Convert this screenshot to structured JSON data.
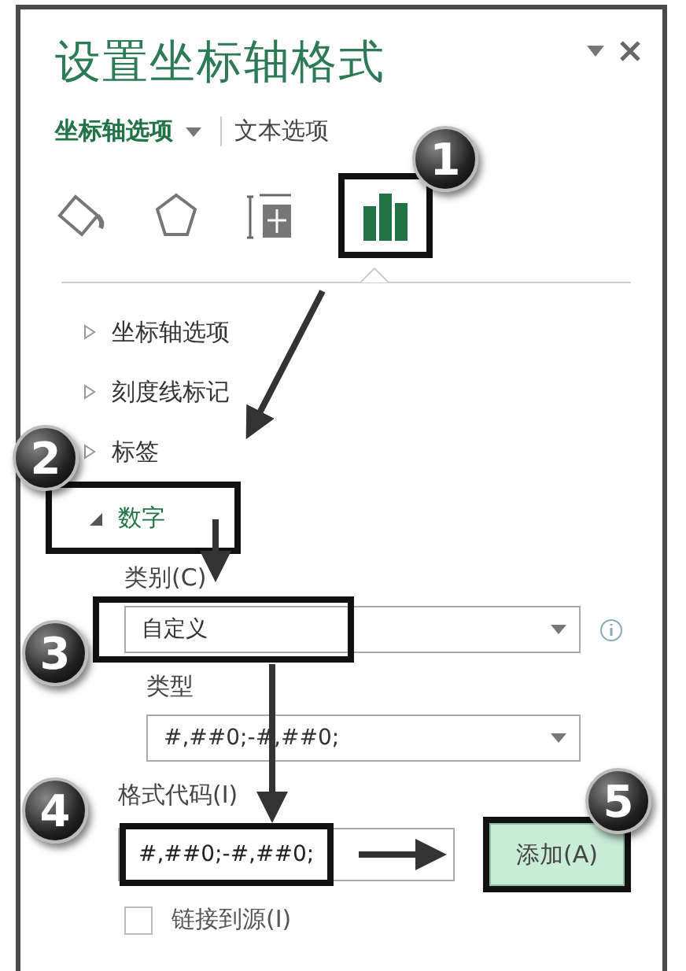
{
  "pane": {
    "title": "设置坐标轴格式",
    "tabs": [
      {
        "label": "坐标轴选项",
        "selected": true
      },
      {
        "label": "文本选项",
        "selected": false
      }
    ],
    "icon_tabs": [
      {
        "kind": "fill",
        "selected": false,
        "callout": false
      },
      {
        "kind": "effects",
        "selected": false,
        "callout": false
      },
      {
        "kind": "size",
        "selected": false,
        "callout": false
      },
      {
        "kind": "axis",
        "selected": true,
        "callout": true
      }
    ],
    "sections": [
      {
        "label": "坐标轴选项",
        "expanded": false,
        "callout": false
      },
      {
        "label": "刻度线标记",
        "expanded": false,
        "callout": false
      },
      {
        "label": "标签",
        "expanded": false,
        "callout": false
      },
      {
        "label": "数字",
        "expanded": true,
        "callout": true
      }
    ],
    "number": {
      "category_label": "类别(C)",
      "category": {
        "value": "自定义",
        "callout": true
      },
      "type_label": "类型",
      "type": {
        "value": "#,##0;-#,##0;",
        "callout": false
      },
      "format_code_label": "格式代码(I)",
      "format_code": {
        "value": "#,##0;-#,##0;",
        "callout": true
      },
      "add_button": {
        "label": "添加(A)",
        "callout": true
      },
      "link_source": {
        "label": "链接到源(I)",
        "checked": false
      }
    }
  },
  "annotations": [
    {
      "label": "1"
    },
    {
      "label": "2"
    },
    {
      "label": "3"
    },
    {
      "label": "4"
    },
    {
      "label": "5"
    }
  ]
}
